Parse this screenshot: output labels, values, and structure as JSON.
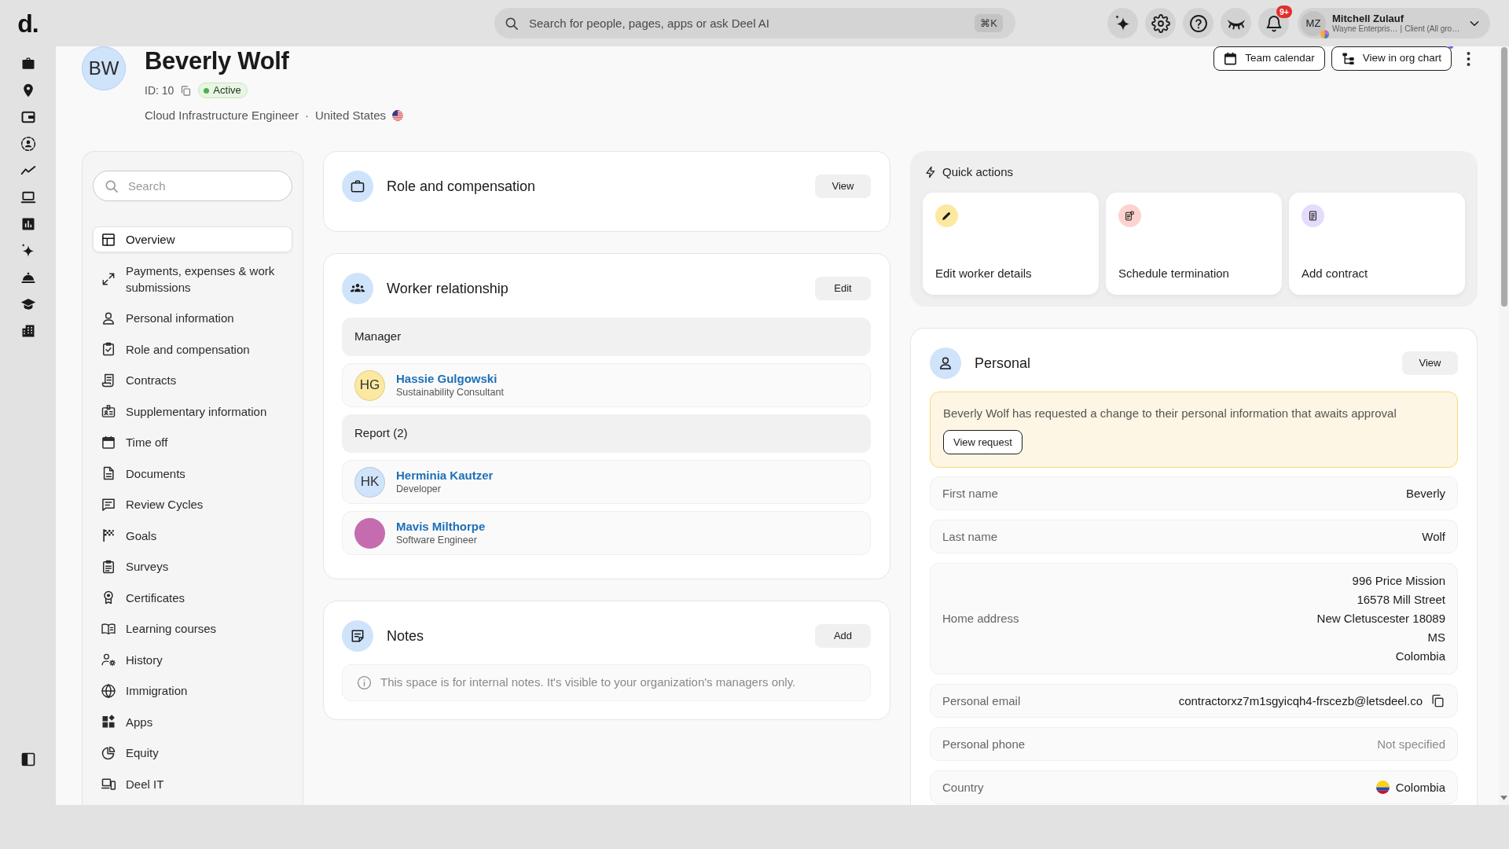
{
  "topbar": {
    "logo": "d.",
    "search": {
      "placeholder": "Search for people, pages, apps or ask Deel AI",
      "shortcut": "⌘K"
    },
    "notification_count": "9+",
    "user": {
      "initials": "MZ",
      "name": "Mitchell Zulauf",
      "organization": "Wayne Enterpris…",
      "separator": "|",
      "role": "Client (All gro…"
    }
  },
  "profile": {
    "initials": "BW",
    "name": "Beverly Wolf",
    "id": "ID: 10",
    "status": "Active",
    "job_title": "Cloud Infrastructure Engineer",
    "separator": "·",
    "country": "United States",
    "actions": [
      "Team calendar",
      "View in org chart"
    ]
  },
  "sidebar": {
    "search": {
      "placeholder": "Search"
    },
    "items": [
      {
        "label": "Overview",
        "selected": true
      },
      {
        "label": "Payments, expenses & work submissions",
        "selected": false
      },
      {
        "label": "Personal information",
        "selected": false
      },
      {
        "label": "Role and compensation",
        "selected": false
      },
      {
        "label": "Contracts",
        "selected": false
      },
      {
        "label": "Supplementary information",
        "selected": false
      },
      {
        "label": "Time off",
        "selected": false
      },
      {
        "label": "Documents",
        "selected": false
      },
      {
        "label": "Review Cycles",
        "selected": false
      },
      {
        "label": "Goals",
        "selected": false
      },
      {
        "label": "Surveys",
        "selected": false
      },
      {
        "label": "Certificates",
        "selected": false
      },
      {
        "label": "Learning courses",
        "selected": false
      },
      {
        "label": "History",
        "selected": false
      },
      {
        "label": "Immigration",
        "selected": false
      },
      {
        "label": "Apps",
        "selected": false
      },
      {
        "label": "Equity",
        "selected": false
      },
      {
        "label": "Deel IT",
        "selected": false
      }
    ]
  },
  "role_card": {
    "title": "Role and compensation",
    "button": "View"
  },
  "worker_relationship": {
    "title": "Worker relationship",
    "button": "Edit",
    "groups": [
      {
        "heading": "Manager",
        "people": [
          {
            "kind": "initials",
            "initials": "HG",
            "color": "#fde8a1",
            "name": "Hassie Gulgowski",
            "role": "Sustainability Consultant"
          }
        ]
      },
      {
        "heading": "Report (2)",
        "people": [
          {
            "kind": "initials",
            "initials": "HK",
            "color": "#cfe3fb",
            "name": "Herminia Kautzer",
            "role": "Developer"
          },
          {
            "kind": "photo",
            "name": "Mavis Milthorpe",
            "role": "Software Engineer"
          }
        ]
      }
    ]
  },
  "notes": {
    "title": "Notes",
    "button": "Add",
    "info": "This space is for internal notes. It's visible to your organization's managers only."
  },
  "quick_actions": {
    "title": "Quick actions",
    "items": [
      {
        "label": "Edit worker details",
        "color": "#fde8a1"
      },
      {
        "label": "Schedule termination",
        "color": "#fcd3ce"
      },
      {
        "label": "Add contract",
        "color": "#e4dcfa"
      }
    ]
  },
  "personal": {
    "title": "Personal",
    "button": "View",
    "alert": {
      "text": "Beverly Wolf has requested a change to their personal information that awaits approval",
      "button": "View request"
    },
    "fields": [
      {
        "kind": "text",
        "label": "First name",
        "value": "Beverly"
      },
      {
        "kind": "text",
        "label": "Last name",
        "value": "Wolf"
      },
      {
        "kind": "address",
        "label": "Home address",
        "lines": [
          "996 Price Mission",
          "16578 Mill Street",
          "New Cletuscester 18089",
          "MS",
          "Colombia"
        ]
      },
      {
        "kind": "copy",
        "label": "Personal email",
        "value": "contractorxz7m1sgyicqh4-frscezb@letsdeel.co"
      },
      {
        "kind": "empty",
        "label": "Personal phone",
        "value": "Not specified"
      },
      {
        "kind": "flag",
        "label": "Country",
        "value": "Colombia"
      }
    ]
  }
}
